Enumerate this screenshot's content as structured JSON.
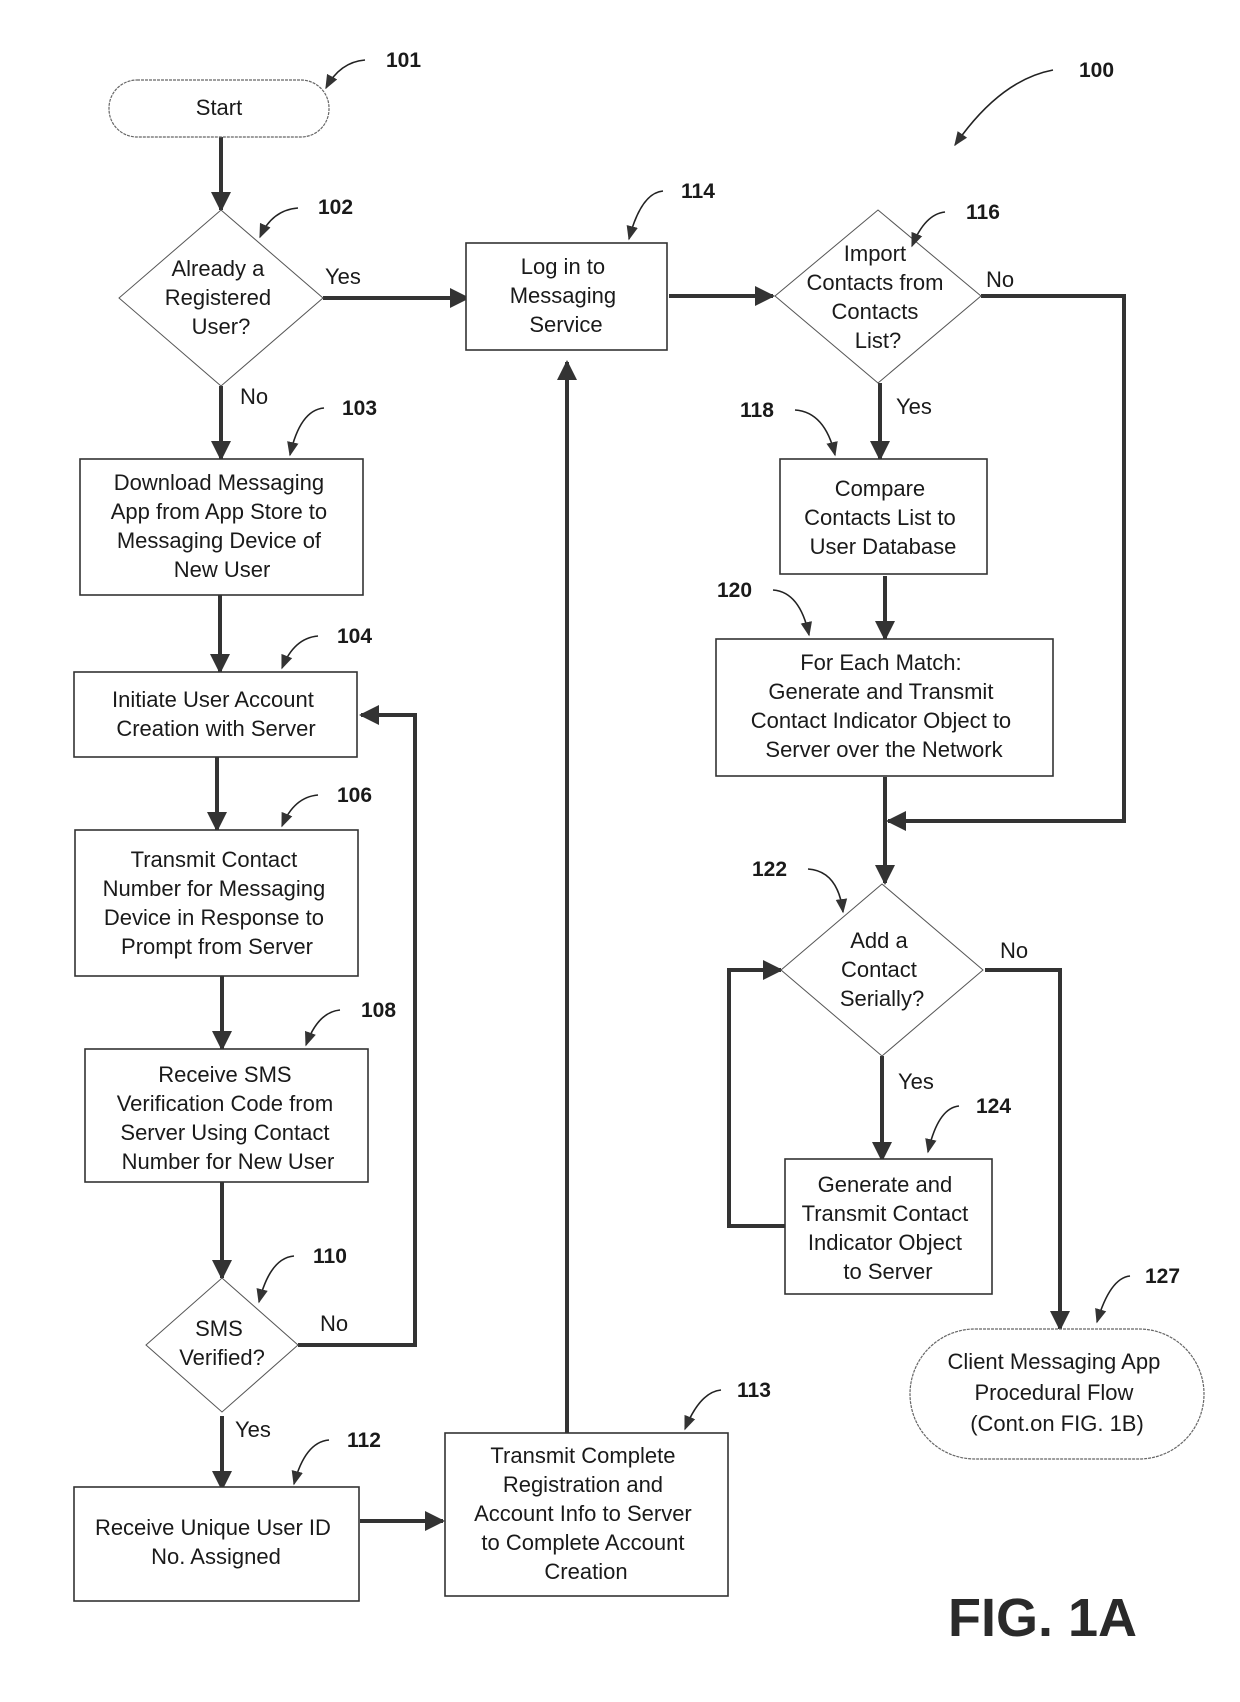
{
  "figure": {
    "label": "FIG. 1A",
    "ref": "100"
  },
  "nodes": {
    "n101": {
      "ref": "101",
      "shape": "terminal",
      "lines": [
        "Start"
      ]
    },
    "n102": {
      "ref": "102",
      "shape": "decision",
      "lines": [
        "Already a",
        "Registered",
        "User?"
      ]
    },
    "n103": {
      "ref": "103",
      "shape": "process",
      "lines": [
        "Download Messaging",
        "App from App Store to",
        "Messaging Device of",
        "New User"
      ]
    },
    "n104": {
      "ref": "104",
      "shape": "process",
      "lines": [
        "Initiate User Account",
        "Creation with Server"
      ]
    },
    "n106": {
      "ref": "106",
      "shape": "process",
      "lines": [
        "Transmit Contact",
        "Number for Messaging",
        "Device in Response to",
        "Prompt from Server"
      ]
    },
    "n108": {
      "ref": "108",
      "shape": "process",
      "lines": [
        "Receive SMS",
        "Verification Code from",
        "Server Using Contact",
        "Number for New User"
      ]
    },
    "n110": {
      "ref": "110",
      "shape": "decision",
      "lines": [
        "SMS",
        "Verified?"
      ]
    },
    "n112": {
      "ref": "112",
      "shape": "process",
      "lines": [
        "Receive Unique User ID",
        "No. Assigned"
      ]
    },
    "n113": {
      "ref": "113",
      "shape": "process",
      "lines": [
        "Transmit Complete",
        "Registration and",
        "Account Info to Server",
        "to Complete Account",
        "Creation"
      ]
    },
    "n114": {
      "ref": "114",
      "shape": "process",
      "lines": [
        "Log in to",
        "Messaging",
        "Service"
      ]
    },
    "n116": {
      "ref": "116",
      "shape": "decision",
      "lines": [
        "Import",
        "Contacts from",
        "Contacts",
        "List?"
      ]
    },
    "n118": {
      "ref": "118",
      "shape": "process",
      "lines": [
        "Compare",
        "Contacts List to",
        "User Database"
      ]
    },
    "n120": {
      "ref": "120",
      "shape": "process",
      "lines": [
        "For Each Match:",
        "Generate and Transmit",
        "Contact Indicator Object to",
        "Server over the Network"
      ]
    },
    "n122": {
      "ref": "122",
      "shape": "decision",
      "lines": [
        "Add a",
        "Contact",
        "Serially?"
      ]
    },
    "n124": {
      "ref": "124",
      "shape": "process",
      "lines": [
        "Generate and",
        "Transmit Contact",
        "Indicator Object",
        "to Server"
      ]
    },
    "n127": {
      "ref": "127",
      "shape": "terminal",
      "lines": [
        "Client Messaging App",
        "Procedural Flow",
        "(Cont.on FIG. 1B)"
      ]
    }
  },
  "edges": [
    {
      "from": "101",
      "to": "102",
      "label": ""
    },
    {
      "from": "102",
      "to": "114",
      "label": "Yes"
    },
    {
      "from": "102",
      "to": "103",
      "label": "No"
    },
    {
      "from": "103",
      "to": "104",
      "label": ""
    },
    {
      "from": "104",
      "to": "106",
      "label": ""
    },
    {
      "from": "106",
      "to": "108",
      "label": ""
    },
    {
      "from": "108",
      "to": "110",
      "label": ""
    },
    {
      "from": "110",
      "to": "104",
      "label": "No"
    },
    {
      "from": "110",
      "to": "112",
      "label": "Yes"
    },
    {
      "from": "112",
      "to": "113",
      "label": ""
    },
    {
      "from": "113",
      "to": "114",
      "label": ""
    },
    {
      "from": "114",
      "to": "116",
      "label": ""
    },
    {
      "from": "116",
      "to": "118",
      "label": "Yes"
    },
    {
      "from": "116",
      "to": "122",
      "label": "No"
    },
    {
      "from": "118",
      "to": "120",
      "label": ""
    },
    {
      "from": "120",
      "to": "122",
      "label": ""
    },
    {
      "from": "122",
      "to": "124",
      "label": "Yes"
    },
    {
      "from": "122",
      "to": "127",
      "label": "No"
    },
    {
      "from": "124",
      "to": "122",
      "label": ""
    }
  ],
  "edge_labels": {
    "e102_yes": "Yes",
    "e102_no": "No",
    "e110_no": "No",
    "e110_yes": "Yes",
    "e116_no": "No",
    "e116_yes": "Yes",
    "e122_no": "No",
    "e122_yes": "Yes"
  }
}
